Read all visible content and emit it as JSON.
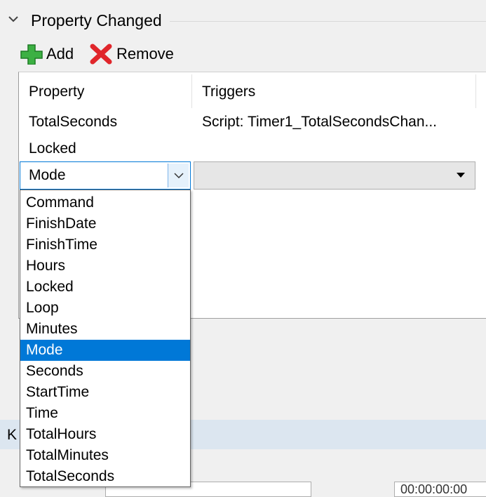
{
  "section": {
    "title": "Property Changed",
    "chevron_icon": "chevron-down-icon"
  },
  "toolbar": {
    "add_label": "Add",
    "add_icon": "green-plus-icon",
    "remove_label": "Remove",
    "remove_icon": "red-x-icon"
  },
  "grid": {
    "columns": [
      "Property",
      "Triggers"
    ],
    "rows": [
      {
        "property": "TotalSeconds",
        "triggers": "Script: Timer1_TotalSecondsChan..."
      },
      {
        "property": "Locked",
        "triggers": ""
      }
    ],
    "editing_row": {
      "property": "Mode",
      "triggers": ""
    }
  },
  "dropdown": {
    "options": [
      "Command",
      "FinishDate",
      "FinishTime",
      "Hours",
      "Locked",
      "Loop",
      "Minutes",
      "Mode",
      "Seconds",
      "StartTime",
      "Time",
      "TotalHours",
      "TotalMinutes",
      "TotalSeconds"
    ],
    "selected": "Mode"
  },
  "lower_panel": {
    "label": "K",
    "field_text": "00:00:00:00"
  },
  "colors": {
    "selection": "#0078d7",
    "add_icon": "#3cb043",
    "remove_icon": "#e0262b"
  }
}
